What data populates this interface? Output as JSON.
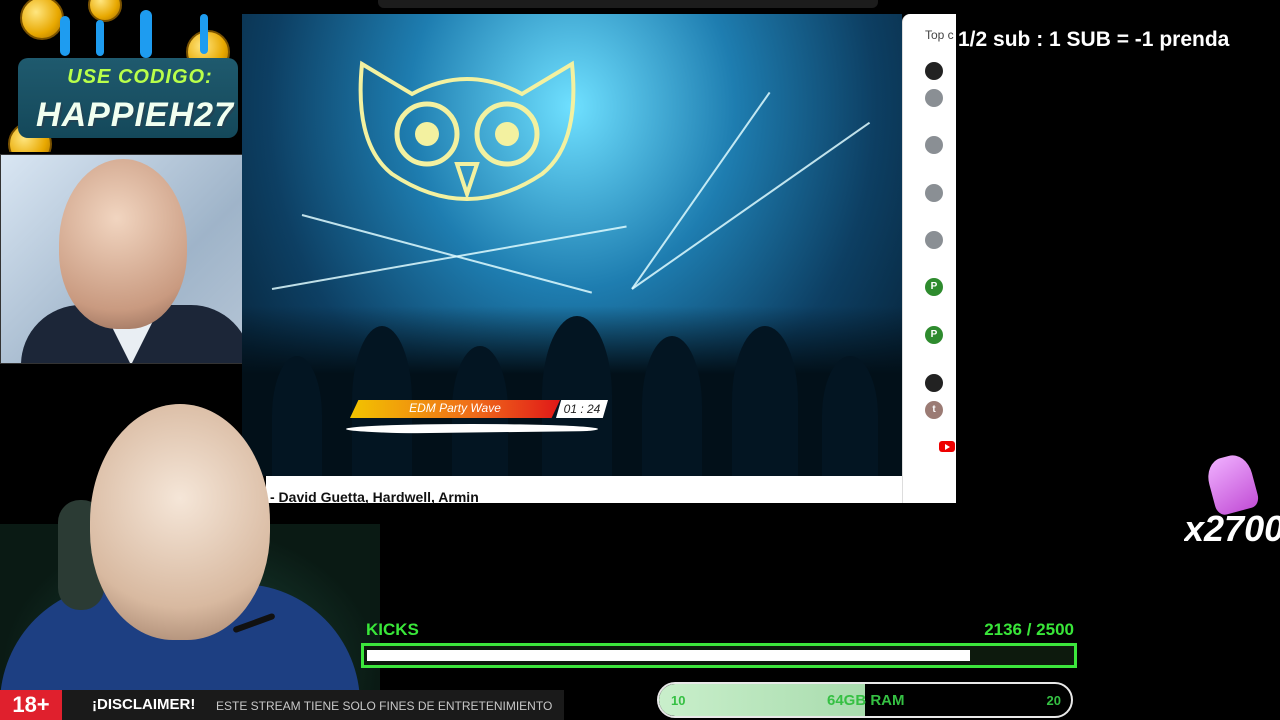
{
  "promo": {
    "label": "USE CODIGO:",
    "code": "HAPPIEH27"
  },
  "video": {
    "track_name": "EDM Party Wave",
    "track_time": "01 : 24",
    "title": "- David Guetta, Hardwell, Armin"
  },
  "sidebar": {
    "label": "Top c",
    "avatars": [
      {
        "letter": "",
        "color": "#222222"
      },
      {
        "letter": "",
        "color": "#8a8f94"
      },
      {
        "letter": "",
        "color": "#8a8f94"
      },
      {
        "letter": "",
        "color": "#8a8f94"
      },
      {
        "letter": "",
        "color": "#8a8f94"
      },
      {
        "letter": "P",
        "color": "#2e8b2e"
      },
      {
        "letter": "P",
        "color": "#2e8b2e"
      },
      {
        "letter": "",
        "color": "#222222"
      },
      {
        "letter": "t",
        "color": "#9b7b74"
      }
    ]
  },
  "sub_goal": "1/2 sub  : 1 SUB = -1 prenda",
  "emoji_counter": {
    "icon": "praying-hands-icon",
    "text": "x2700"
  },
  "kicks": {
    "label": "KICKS",
    "current": 2136,
    "goal": 2500,
    "count_text": "2136  / 2500",
    "fill_fraction": 0.854
  },
  "ram": {
    "min": "10",
    "label": "64GB RAM",
    "max": "20",
    "fill_fraction": 0.5
  },
  "disclaimer": {
    "age": "18+",
    "title": "¡DISCLAIMER!",
    "text": "ESTE STREAM TIENE SOLO FINES DE ENTRETENIMIENTO"
  },
  "colors": {
    "accent_green": "#3ce63c",
    "age_red": "#e0202d"
  }
}
